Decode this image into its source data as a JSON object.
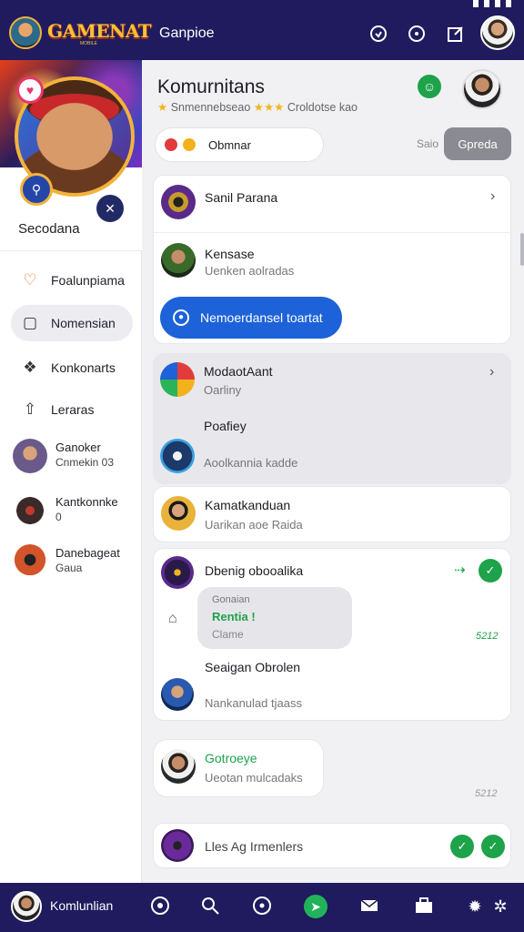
{
  "app": {
    "logo_text": "GAMENAT",
    "logo_sub": "MOBILE",
    "title": "Ganpioe"
  },
  "colors": {
    "nav_bg": "#1f1b5e",
    "accent_blue": "#1d62d8",
    "accent_green": "#1ea24a",
    "gold": "#f3b23c"
  },
  "topbar": {
    "icons": [
      "sync-icon",
      "compass-icon",
      "edit-icon"
    ]
  },
  "profile": {
    "name": "Secodana"
  },
  "sidebar": {
    "items": [
      {
        "label": "Foalunpiama",
        "icon": "heart-icon"
      },
      {
        "label": "Nomensian",
        "icon": "square-icon",
        "active": true
      },
      {
        "label": "Konkonarts",
        "icon": "puzzle-icon"
      },
      {
        "label": "Leraras",
        "icon": "tag-icon"
      }
    ],
    "friends": [
      {
        "name": "Ganoker",
        "sub": "Cnmekin 03"
      },
      {
        "name": "Kantkonnke",
        "sub": "0"
      },
      {
        "name": "Danebageat",
        "sub": "Gaua"
      }
    ]
  },
  "header": {
    "title": "Komurnitans",
    "sub_left": "Snmennebseao",
    "sub_right": "Croldotse kao",
    "stars": "★★★"
  },
  "search": {
    "label": "Obmnar",
    "tag": "Saio",
    "open_button": "Gpreda"
  },
  "cards": {
    "c1": {
      "row1": {
        "title": "Sanil Parana"
      },
      "row2": {
        "title": "Kensase",
        "sub": "Uenken aolradas"
      },
      "button": "Nemoerdansel toartat"
    },
    "c2": {
      "row1": {
        "title": "ModaotAant",
        "sub": "Oarliny"
      },
      "row2": {
        "title": "Poafiey"
      },
      "row3": {
        "sub": "Aoolkannia kadde"
      }
    },
    "c3": {
      "title": "Kamatkanduan",
      "sub": "Uarikan aoe Raida"
    },
    "c4": {
      "title": "Dbenig obooalika",
      "bubble": {
        "line1": "Gonaian",
        "line2": "Rentia !",
        "line3": "Clame"
      },
      "time": "5212",
      "row2": {
        "title": "Seaigan Obrolen",
        "sub": "Nankanulad tjaass"
      }
    },
    "c5": {
      "title": "Gotroeye",
      "sub": "Ueotan mulcadaks",
      "time": "5212"
    },
    "c6": {
      "title": "Lles Ag Irmenlers"
    }
  },
  "bottombar": {
    "label": "Komlunlian",
    "icons": [
      "chat-icon",
      "search-icon",
      "compass-icon",
      "home-icon",
      "mail-icon",
      "briefcase-icon",
      "settings-icon",
      "bug-icon"
    ]
  }
}
